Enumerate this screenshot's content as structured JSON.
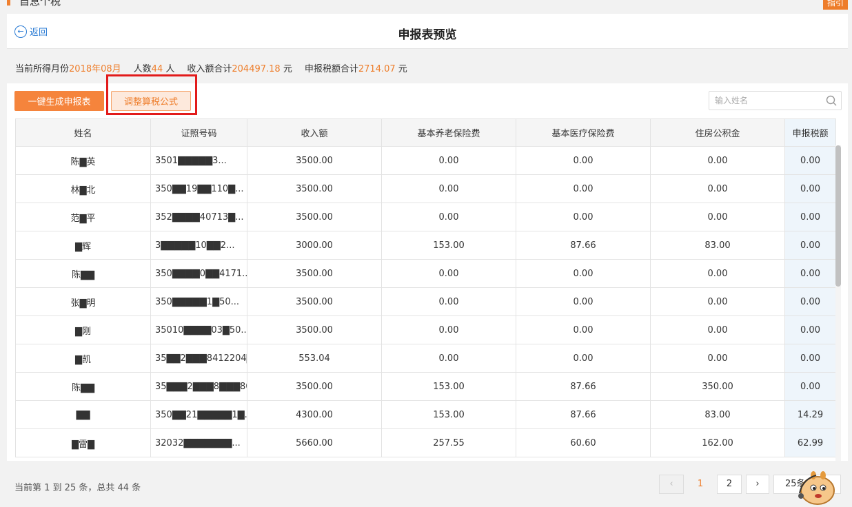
{
  "top": {
    "title": "自息个税",
    "badge": "指引"
  },
  "header": {
    "back_label": "返回",
    "title": "申报表预览"
  },
  "summary": {
    "month_label": "当前所得月份",
    "month_value": "2018年08月",
    "count_label": "人数",
    "count_value": "44",
    "count_unit": "人",
    "income_label": "收入额合计",
    "income_value": "204497.18",
    "income_unit": "元",
    "tax_label": "申报税额合计",
    "tax_value": "2714.07",
    "tax_unit": "元"
  },
  "toolbar": {
    "generate_label": "一键生成申报表",
    "adjust_label": "调整算税公式",
    "search_placeholder": "输入姓名"
  },
  "table": {
    "columns": [
      "姓名",
      "证照号码",
      "收入额",
      "基本养老保险费",
      "基本医疗保险费",
      "住房公积金",
      "申报税额"
    ],
    "rows": [
      {
        "name": "陈▇英",
        "id": "3501▇▇▇▇▇3...",
        "income": "3500.00",
        "pension": "0.00",
        "medical": "0.00",
        "fund": "0.00",
        "tax": "0.00"
      },
      {
        "name": "林▇北",
        "id": "350▇▇19▇▇110▇...",
        "income": "3500.00",
        "pension": "0.00",
        "medical": "0.00",
        "fund": "0.00",
        "tax": "0.00"
      },
      {
        "name": "范▇平",
        "id": "352▇▇▇▇40713▇...",
        "income": "3500.00",
        "pension": "0.00",
        "medical": "0.00",
        "fund": "0.00",
        "tax": "0.00"
      },
      {
        "name": "▇辉",
        "id": "3▇▇▇▇▇10▇▇2...",
        "income": "3000.00",
        "pension": "153.00",
        "medical": "87.66",
        "fund": "83.00",
        "tax": "0.00"
      },
      {
        "name": "陈▇▇",
        "id": "350▇▇▇▇0▇▇4171...",
        "income": "3500.00",
        "pension": "0.00",
        "medical": "0.00",
        "fund": "0.00",
        "tax": "0.00"
      },
      {
        "name": "张▇明",
        "id": "350▇▇▇▇▇1▇50...",
        "income": "3500.00",
        "pension": "0.00",
        "medical": "0.00",
        "fund": "0.00",
        "tax": "0.00"
      },
      {
        "name": "▇刚",
        "id": "35010▇▇▇▇03▇50...",
        "income": "3500.00",
        "pension": "0.00",
        "medical": "0.00",
        "fund": "0.00",
        "tax": "0.00"
      },
      {
        "name": "▇凯",
        "id": "35▇▇2▇▇▇8412204▇...",
        "income": "553.04",
        "pension": "0.00",
        "medical": "0.00",
        "fund": "0.00",
        "tax": "0.00"
      },
      {
        "name": "陈▇▇",
        "id": "35▇▇▇2▇▇▇8▇▇▇80...",
        "income": "3500.00",
        "pension": "153.00",
        "medical": "87.66",
        "fund": "350.00",
        "tax": "0.00"
      },
      {
        "name": "▇▇",
        "id": "350▇▇21▇▇▇▇▇1▇...",
        "income": "4300.00",
        "pension": "153.00",
        "medical": "87.66",
        "fund": "83.00",
        "tax": "14.29"
      },
      {
        "name": "▇雷▇",
        "id": "32032▇▇▇▇▇▇▇...",
        "income": "5660.00",
        "pension": "257.55",
        "medical": "60.60",
        "fund": "162.00",
        "tax": "62.99"
      }
    ]
  },
  "footer": {
    "info": "当前第 1 到 25 条，总共 44 条",
    "page1": "1",
    "page2": "2",
    "prev_icon": "chevron-left-icon",
    "next_icon": "chevron-right-icon",
    "page_size": "25条"
  },
  "colors": {
    "accent": "#ee7d2a",
    "link": "#2a7bd4",
    "highlight": "#e21b1b"
  }
}
